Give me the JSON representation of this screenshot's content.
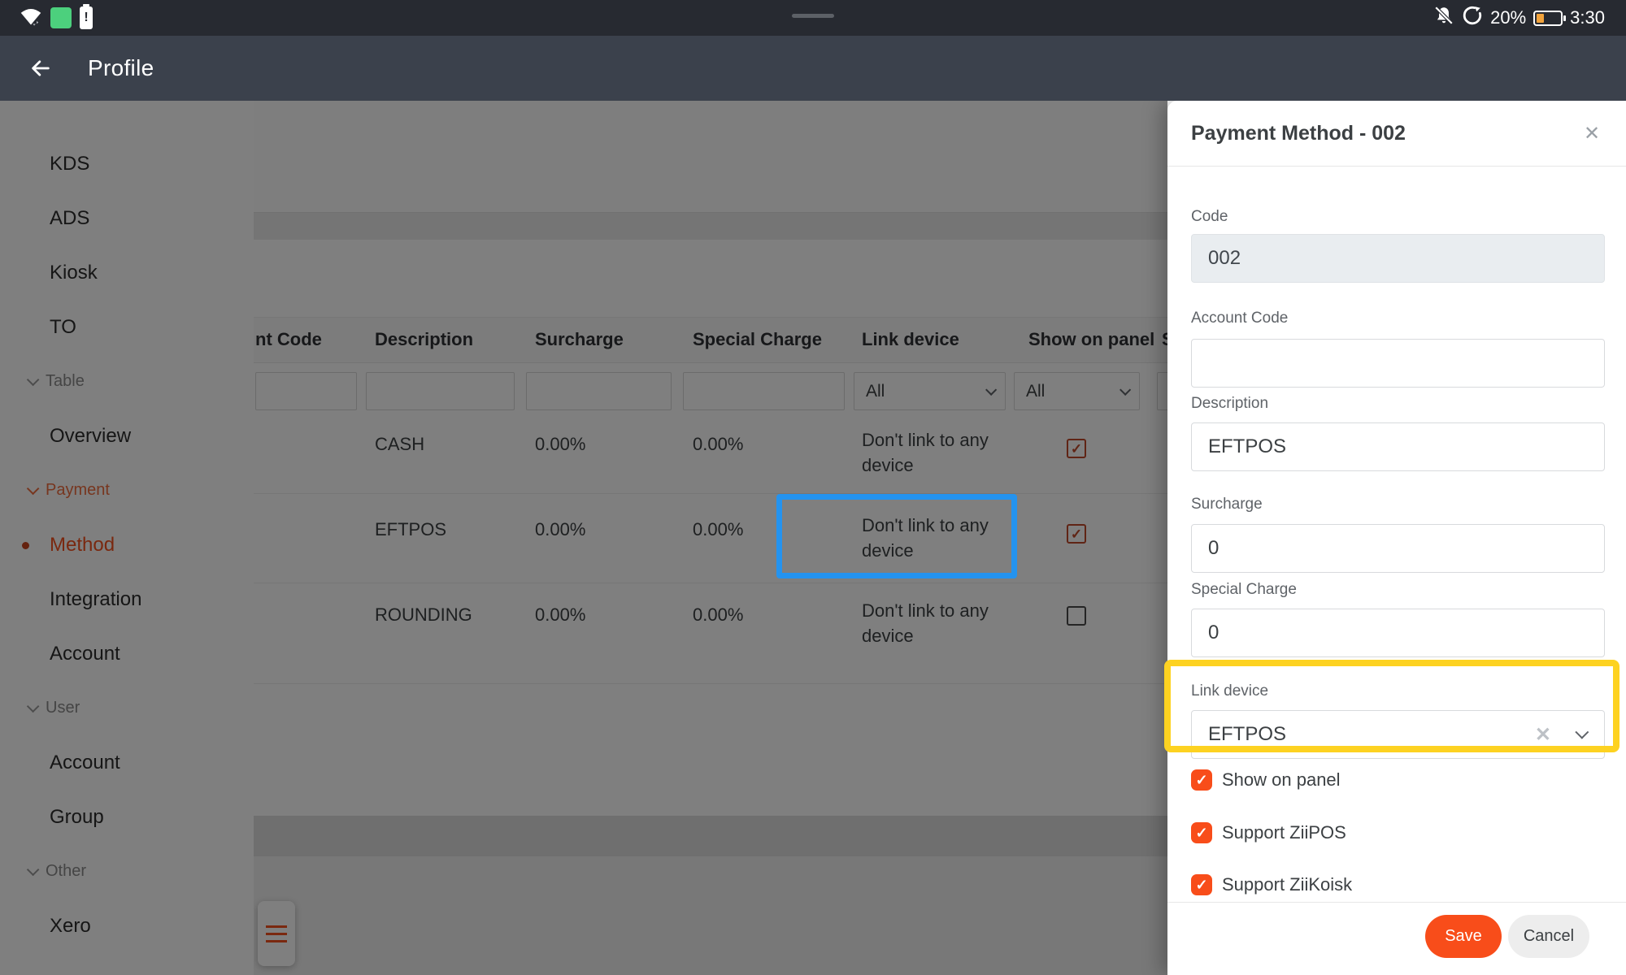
{
  "status_bar": {
    "battery_percent": "20%",
    "time": "3:30"
  },
  "app_bar": {
    "title": "Profile"
  },
  "sidebar": {
    "items": [
      {
        "type": "item",
        "label": "KDS"
      },
      {
        "type": "item",
        "label": "ADS"
      },
      {
        "type": "item",
        "label": "Kiosk"
      },
      {
        "type": "item",
        "label": "TO"
      },
      {
        "type": "group",
        "label": "Table"
      },
      {
        "type": "item",
        "label": "Overview"
      },
      {
        "type": "group",
        "label": "Payment",
        "active": true
      },
      {
        "type": "item",
        "label": "Method",
        "active": true
      },
      {
        "type": "item",
        "label": "Integration"
      },
      {
        "type": "item",
        "label": "Account"
      },
      {
        "type": "group",
        "label": "User"
      },
      {
        "type": "item",
        "label": "Account"
      },
      {
        "type": "item",
        "label": "Group"
      },
      {
        "type": "group",
        "label": "Other"
      },
      {
        "type": "item",
        "label": "Xero"
      }
    ]
  },
  "main": {
    "table": {
      "columns": {
        "payment_code_clipped": "nt Code",
        "description": "Description",
        "surcharge": "Surcharge",
        "special_charge": "Special Charge",
        "link_device": "Link device",
        "show_on_panel": "Show on panel",
        "clipped_next": "S"
      },
      "filters": {
        "link_device": "All",
        "show_on_panel": "All"
      },
      "rows": [
        {
          "description": "CASH",
          "surcharge": "0.00%",
          "special_charge": "0.00%",
          "link_device": "Don't link to any device",
          "show_on_panel": true
        },
        {
          "description": "EFTPOS",
          "surcharge": "0.00%",
          "special_charge": "0.00%",
          "link_device": "Don't link to any device",
          "show_on_panel": true
        },
        {
          "description": "ROUNDING",
          "surcharge": "0.00%",
          "special_charge": "0.00%",
          "link_device": "Don't link to any device",
          "show_on_panel": false
        }
      ]
    }
  },
  "drawer": {
    "title": "Payment Method - 002",
    "fields": {
      "code": {
        "label": "Code",
        "value": "002",
        "disabled": true
      },
      "account_code": {
        "label": "Account Code",
        "value": ""
      },
      "description": {
        "label": "Description",
        "value": "EFTPOS"
      },
      "surcharge": {
        "label": "Surcharge",
        "value": "0"
      },
      "special_charge": {
        "label": "Special Charge",
        "value": "0"
      },
      "link_device": {
        "label": "Link device",
        "value": "EFTPOS"
      }
    },
    "checkboxes": [
      {
        "label": "Show on panel",
        "checked": true
      },
      {
        "label": "Support ZiiPOS",
        "checked": true
      },
      {
        "label": "Support ZiiKoisk",
        "checked": true
      }
    ],
    "buttons": {
      "save": "Save",
      "cancel": "Cancel"
    }
  },
  "colors": {
    "accent_orange": "#f4511e",
    "checkbox_orange": "#f84d1a",
    "highlight_blue": "#2493ef",
    "highlight_yellow": "#fdd221",
    "appbar_bg": "#3b414c",
    "statusbar_bg": "#272a31",
    "app_square_green": "#4cd07d"
  }
}
